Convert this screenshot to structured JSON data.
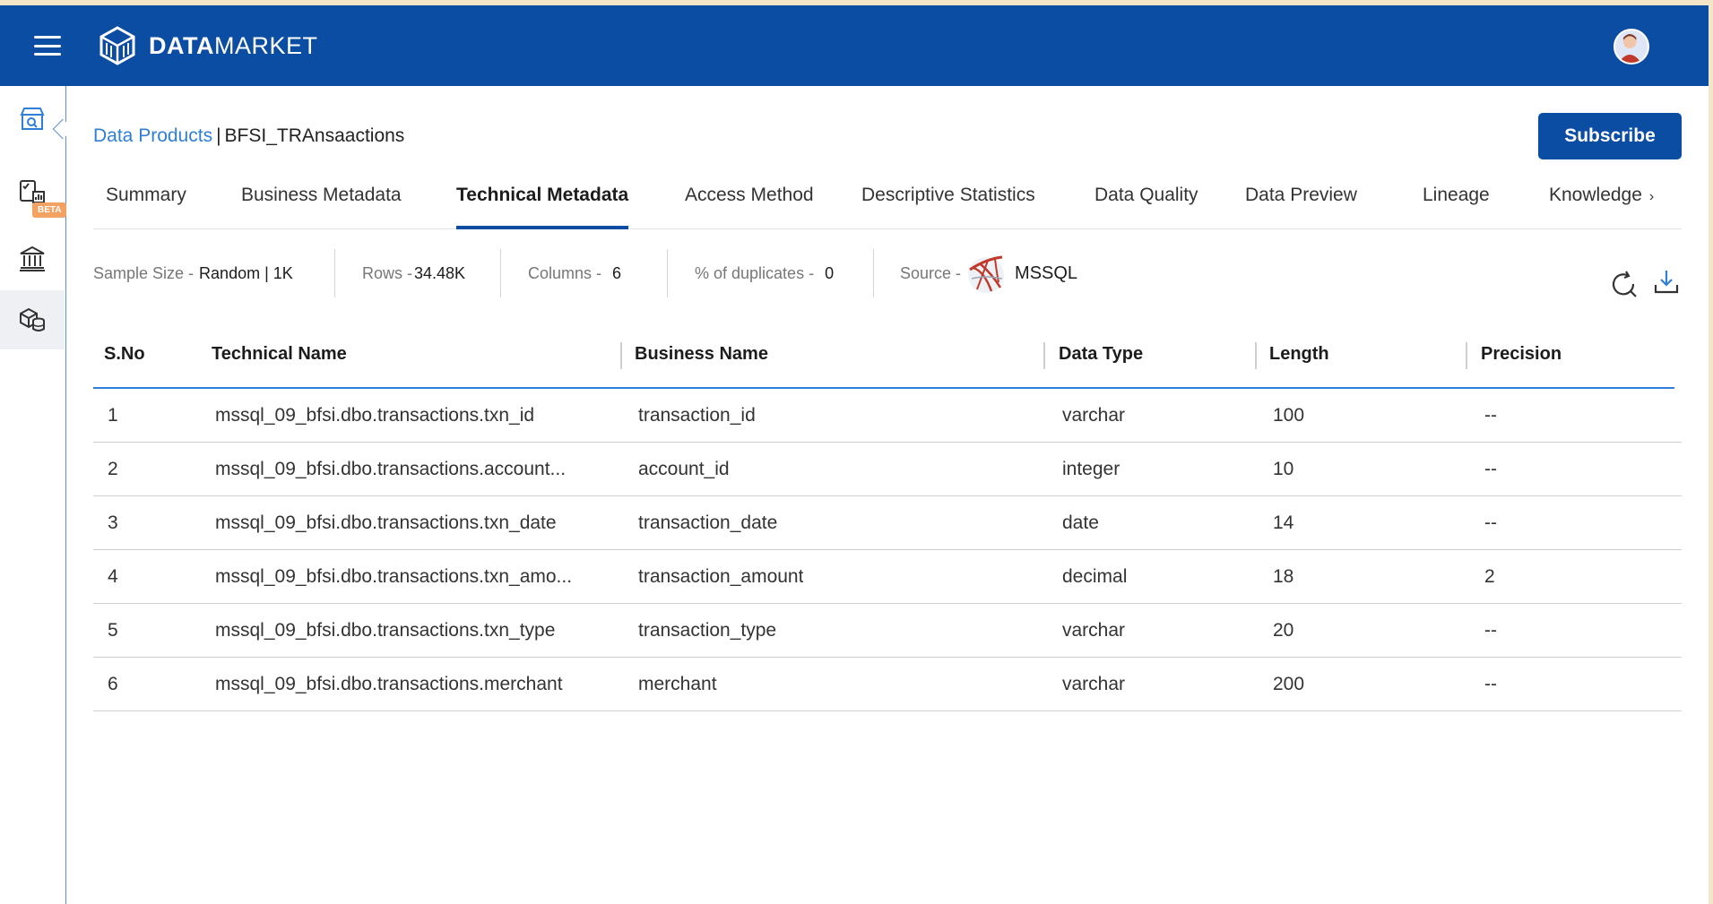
{
  "app": {
    "brand_bold": "DATA",
    "brand_light": "MARKET",
    "colors": {
      "header": "#0a4da3",
      "accent": "#2f7ed8",
      "beta": "#f4a261"
    }
  },
  "sidebar": {
    "items": [
      {
        "icon": "store-search-icon"
      },
      {
        "icon": "chart-checklist-icon",
        "badge": "BETA"
      },
      {
        "icon": "bank-building-icon"
      },
      {
        "icon": "database-cube-icon"
      }
    ]
  },
  "breadcrumb": {
    "link": "Data Products",
    "separator": "|",
    "current": "BFSI_TRAnsaactions"
  },
  "actions": {
    "subscribe_label": "Subscribe"
  },
  "tabs": [
    {
      "label": "Summary"
    },
    {
      "label": "Business Metadata"
    },
    {
      "label": "Technical Metadata",
      "active": true
    },
    {
      "label": "Access Method"
    },
    {
      "label": "Descriptive Statistics"
    },
    {
      "label": "Data Quality"
    },
    {
      "label": "Data Preview"
    },
    {
      "label": "Lineage"
    },
    {
      "label": "Knowledge"
    }
  ],
  "stats": {
    "sample_size": {
      "label": "Sample Size -",
      "value": "Random | 1K"
    },
    "rows": {
      "label": "Rows -",
      "value": "34.48K"
    },
    "columns": {
      "label": "Columns -",
      "value": "6"
    },
    "duplicates": {
      "label": "% of duplicates -",
      "value": "0"
    },
    "source": {
      "label": "Source -",
      "value": "MSSQL",
      "icon": "mssql-logo-icon"
    }
  },
  "table": {
    "headers": [
      "S.No",
      "Technical Name",
      "Business Name",
      "Data Type",
      "Length",
      "Precision"
    ],
    "rows": [
      [
        "1",
        "mssql_09_bfsi.dbo.transactions.txn_id",
        "transaction_id",
        "varchar",
        "100",
        "--"
      ],
      [
        "2",
        "mssql_09_bfsi.dbo.transactions.account...",
        "account_id",
        "integer",
        "10",
        "--"
      ],
      [
        "3",
        "mssql_09_bfsi.dbo.transactions.txn_date",
        "transaction_date",
        "date",
        "14",
        "--"
      ],
      [
        "4",
        "mssql_09_bfsi.dbo.transactions.txn_amo...",
        "transaction_amount",
        "decimal",
        "18",
        "2"
      ],
      [
        "5",
        "mssql_09_bfsi.dbo.transactions.txn_type",
        "transaction_type",
        "varchar",
        "20",
        "--"
      ],
      [
        "6",
        "mssql_09_bfsi.dbo.transactions.merchant",
        "merchant",
        "varchar",
        "200",
        "--"
      ]
    ]
  }
}
